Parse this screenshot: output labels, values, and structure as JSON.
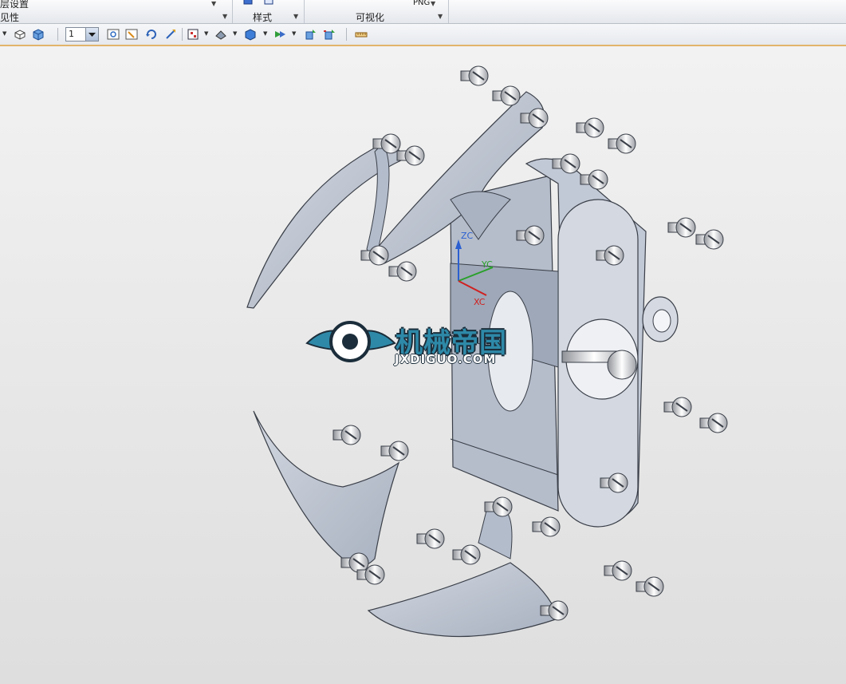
{
  "ribbon": {
    "group1_top": "层设置",
    "group1_label": "见性",
    "group2_label": "样式",
    "group3_top": "PNG",
    "group3_label": "可视化"
  },
  "toolbar": {
    "layer_value": "1"
  },
  "triad": {
    "z_label": "ZC",
    "y_label": "YC",
    "x_label": "XC"
  },
  "watermark": {
    "title": "机械帝国",
    "subtitle": "JXDIGUO.COM"
  },
  "colors": {
    "part_fill": "#c2c9d6",
    "part_stroke": "#3a3f48",
    "bolt_fill": "#e9eaec",
    "accent_toolbar": "#e2b46a"
  },
  "icons": [
    "wireframe-box-icon",
    "shaded-box-icon",
    "layer-dropdown-icon",
    "fit-view-icon",
    "zoom-icon",
    "rotate-icon",
    "pan-icon",
    "view-orient-icon",
    "render-style-icon",
    "shaded-view-icon",
    "section-view-icon",
    "snap-icon",
    "measure-icon"
  ]
}
